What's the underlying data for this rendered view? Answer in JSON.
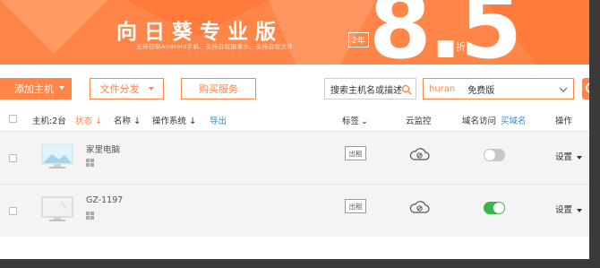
{
  "banner": {
    "title": "向日葵专业版",
    "subtitle": "支持控制Android手机、支持远程摄像头、支持远程文件",
    "years": "2年",
    "big_number": "8.5",
    "discount_unit": "折",
    "color": "#ff8548"
  },
  "toolbar": {
    "add_host_label": "添加主机",
    "file_dist_label": "文件分发",
    "buy_service_label": "购买服务",
    "search_placeholder": "搜索主机名或描述",
    "promo_brand": "huran",
    "promo_text": "免费版"
  },
  "table": {
    "host_count_label": "主机:2台",
    "status_label": "状态",
    "name_label": "名称",
    "os_label": "操作系统",
    "export_label": "导出",
    "tag_label": "标签",
    "cloud_label": "云监控",
    "domain_label": "域名访问",
    "buy_domain_label": "买域名",
    "action_label": "操作"
  },
  "rows": [
    {
      "name": "家里电脑",
      "os_icon": "windows-icon",
      "tag_button": "出租",
      "domain_access": false,
      "action": "设置"
    },
    {
      "name": "GZ-1197",
      "os_icon": "windows-icon",
      "tag_button": "出租",
      "domain_access": true,
      "action": "设置"
    }
  ]
}
